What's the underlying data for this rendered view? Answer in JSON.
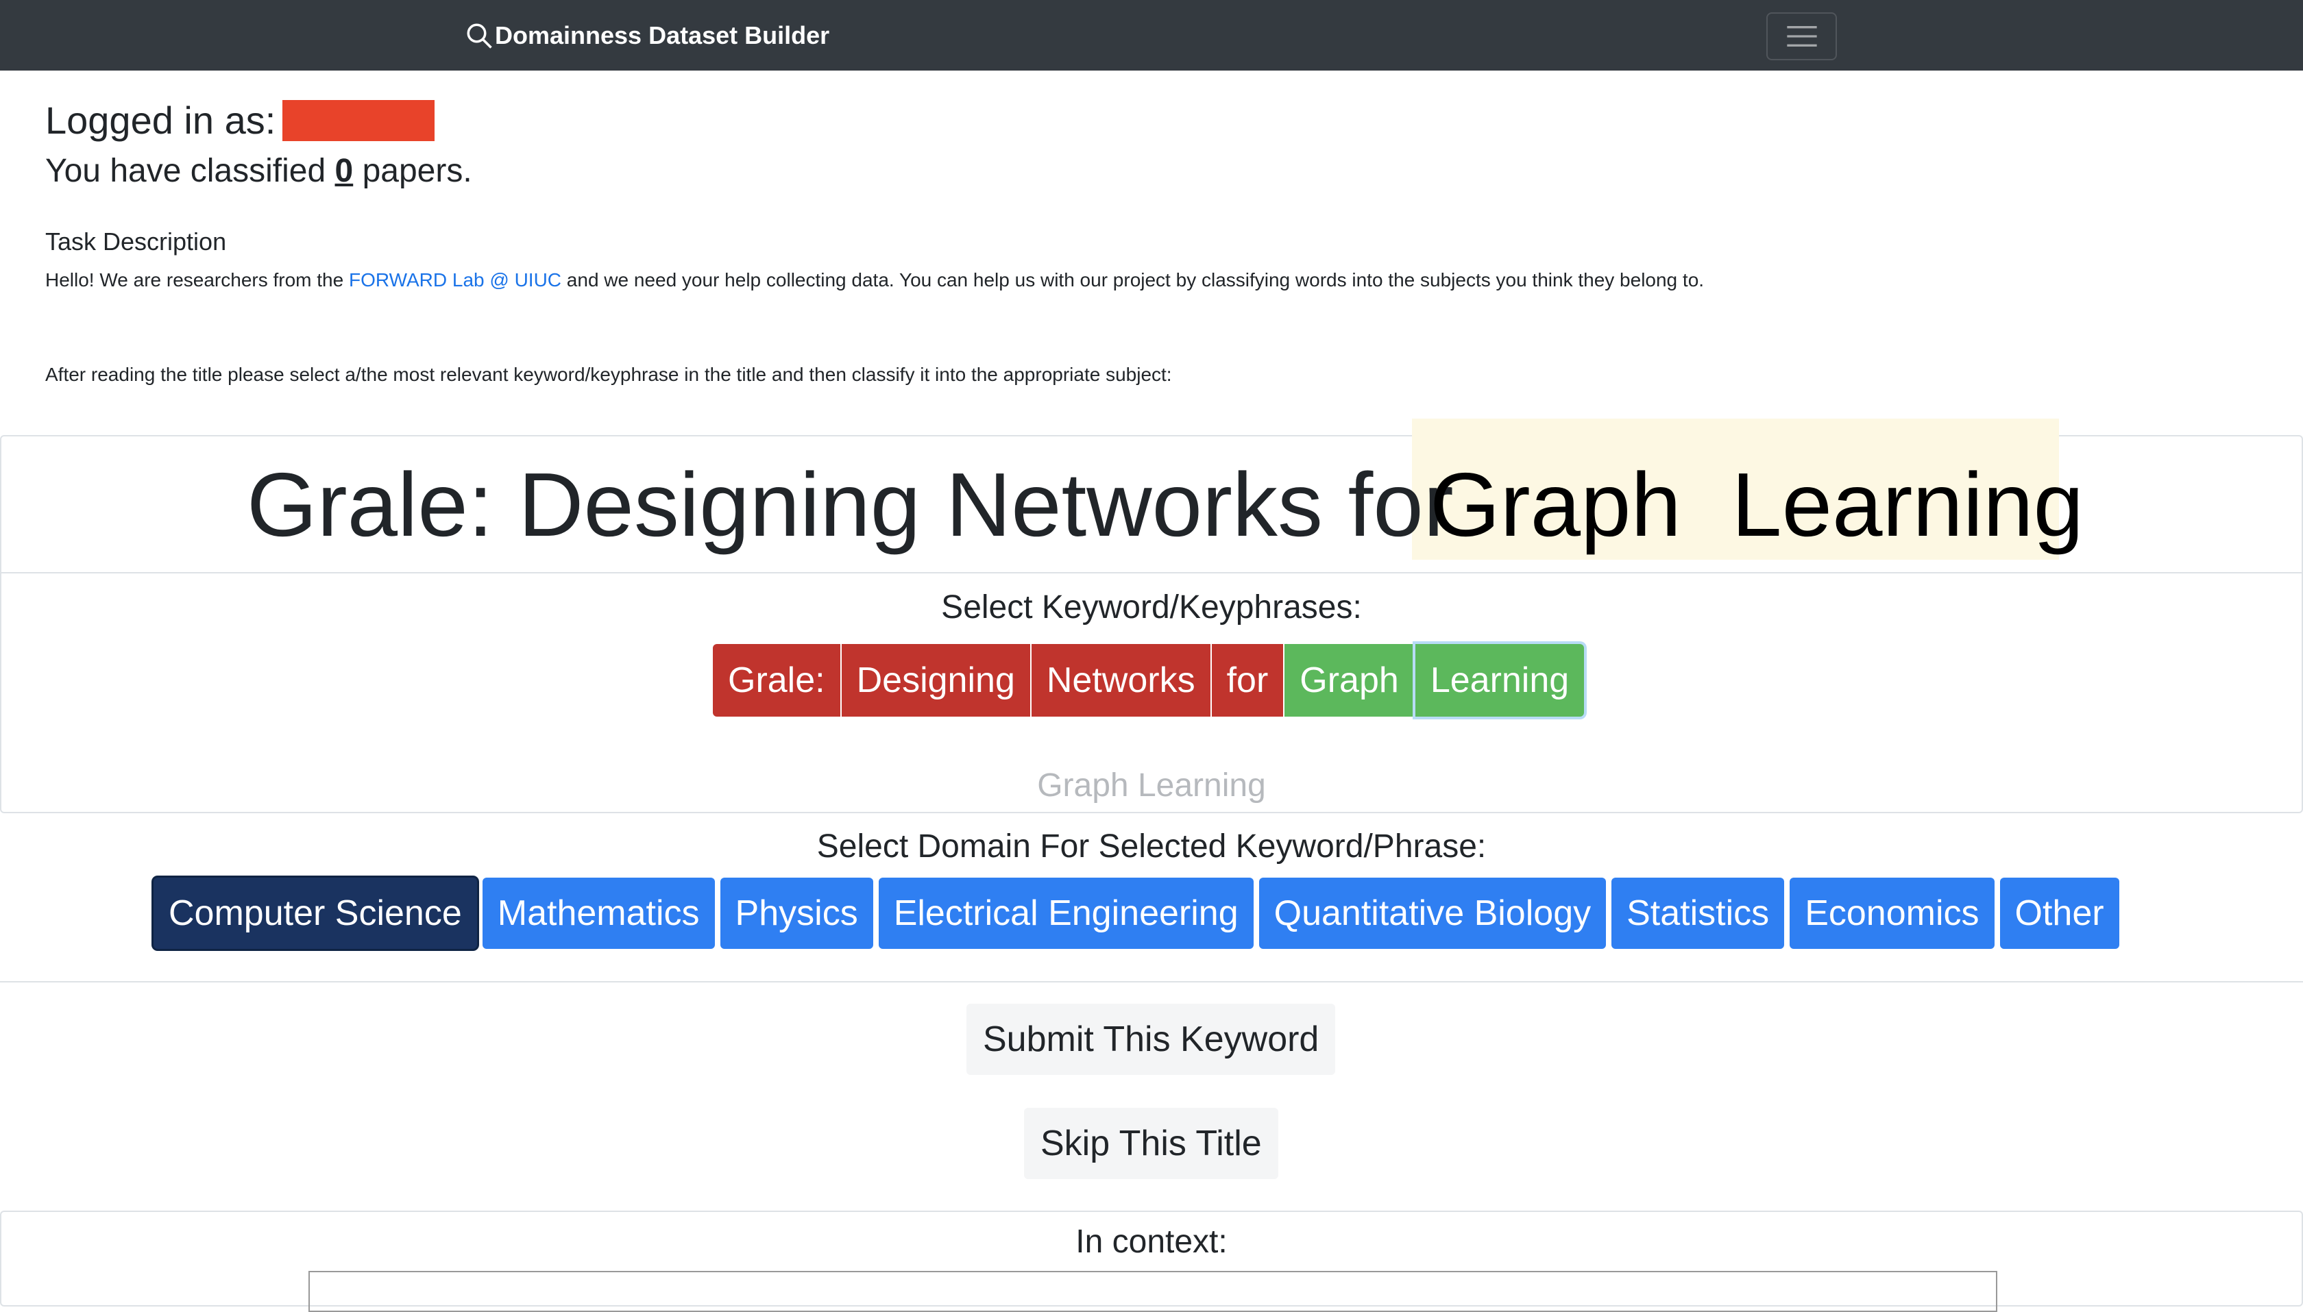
{
  "navbar": {
    "brand": "Domainness Dataset Builder",
    "search_icon": "search-icon",
    "menu_icon": "hamburger-menu-icon"
  },
  "user": {
    "logged_in_label": "Logged in as:",
    "classified_prefix": "You have classified",
    "classified_count": "0",
    "classified_suffix": "papers."
  },
  "task": {
    "title": "Task Description",
    "hello_prefix": "Hello! We are researchers from the",
    "lab_link": "FORWARD Lab @ UIUC",
    "hello_suffix": "and we need your help collecting data. You can help us with our project by classifying words into the subjects you think they belong to.",
    "instruction": "After reading the title please select a/the most relevant keyword/keyphrase in the title and then classify it into the appropriate subject:"
  },
  "paper": {
    "title_plain": "Grale: Designing Networks for",
    "title_highlight": "Graph  Learning",
    "select_label": "Select Keyword/Keyphrases:",
    "keywords": [
      {
        "label": "Grale:",
        "state": "unselected"
      },
      {
        "label": "Designing",
        "state": "unselected"
      },
      {
        "label": "Networks",
        "state": "unselected"
      },
      {
        "label": "for",
        "state": "unselected"
      },
      {
        "label": "Graph",
        "state": "selected"
      },
      {
        "label": "Learning",
        "state": "selected"
      }
    ],
    "selected_phrase": "Graph Learning"
  },
  "domain": {
    "label": "Select Domain For Selected Keyword/Phrase:",
    "options": [
      "Computer Science",
      "Mathematics",
      "Physics",
      "Electrical Engineering",
      "Quantitative Biology",
      "Statistics",
      "Economics",
      "Other"
    ],
    "selected": "Computer Science"
  },
  "actions": {
    "submit": "Submit This Keyword",
    "skip": "Skip This Title"
  },
  "context": {
    "label": "In context:"
  },
  "colors": {
    "navbar": "#343a40",
    "keyword_unselected": "#c0342d",
    "keyword_selected": "#5cb85c",
    "domain_button": "#2f7ff2",
    "domain_selected": "#1a3360",
    "highlight": "#fdf8e3",
    "redaction": "#e8432a"
  }
}
